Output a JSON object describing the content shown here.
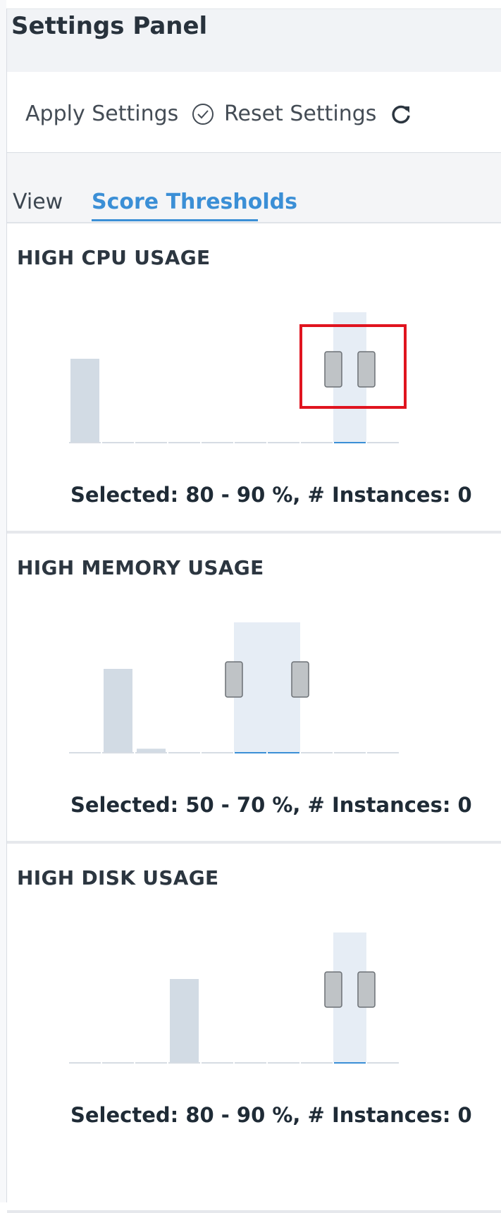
{
  "panel": {
    "title": "Settings Panel"
  },
  "actions": {
    "apply_label": "Apply Settings",
    "apply_icon": "check-circle-icon",
    "reset_label": "Reset Settings",
    "reset_icon": "refresh-icon"
  },
  "tabs": [
    {
      "label": "View",
      "active": false
    },
    {
      "label": "Score Thresholds",
      "active": true
    }
  ],
  "colors": {
    "accent": "#3b8fd6",
    "bar": "#d2dbe4",
    "selected_band": "#e6edf5",
    "handle": "#bfc3c6",
    "highlight": "#e0141f"
  },
  "thresholds": [
    {
      "title": "HIGH CPU USAGE",
      "summary": "Selected: 80 - 90 %, # Instances: 0",
      "chart_data": {
        "type": "bar",
        "categories": [
          "0-10",
          "10-20",
          "20-30",
          "30-40",
          "40-50",
          "50-60",
          "60-70",
          "70-80",
          "80-90",
          "90-100"
        ],
        "values": [
          100,
          0,
          0,
          0,
          0,
          0,
          0,
          0,
          0,
          0
        ],
        "selected_range": [
          80,
          90
        ]
      }
    },
    {
      "title": "HIGH MEMORY USAGE",
      "summary": "Selected: 50 - 70 %, # Instances: 0",
      "chart_data": {
        "type": "bar",
        "categories": [
          "0-10",
          "10-20",
          "20-30",
          "30-40",
          "40-50",
          "50-60",
          "60-70",
          "70-80",
          "80-90",
          "90-100"
        ],
        "values": [
          0,
          100,
          4,
          0,
          0,
          0,
          0,
          0,
          0,
          0
        ],
        "selected_range": [
          50,
          70
        ]
      }
    },
    {
      "title": "HIGH DISK USAGE",
      "summary": "Selected: 80 - 90 %, # Instances: 0",
      "chart_data": {
        "type": "bar",
        "categories": [
          "0-10",
          "10-20",
          "20-30",
          "30-40",
          "40-50",
          "50-60",
          "60-70",
          "70-80",
          "80-90",
          "90-100"
        ],
        "values": [
          0,
          0,
          0,
          100,
          0,
          0,
          0,
          0,
          0,
          0
        ],
        "selected_range": [
          80,
          90
        ]
      }
    }
  ]
}
